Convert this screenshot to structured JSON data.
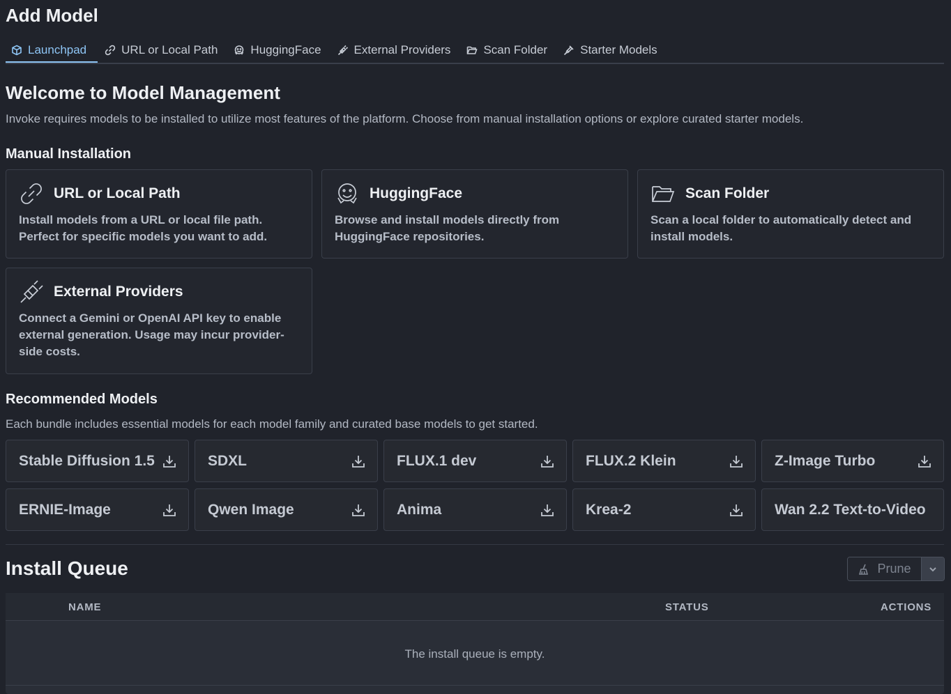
{
  "page": {
    "title": "Add Model"
  },
  "tabs": [
    {
      "label": "Launchpad",
      "icon": "cube-icon",
      "active": true
    },
    {
      "label": "URL or Local Path",
      "icon": "link-icon",
      "active": false
    },
    {
      "label": "HuggingFace",
      "icon": "huggingface-icon",
      "active": false
    },
    {
      "label": "External Providers",
      "icon": "plug-icon",
      "active": false
    },
    {
      "label": "Scan Folder",
      "icon": "folder-icon",
      "active": false
    },
    {
      "label": "Starter Models",
      "icon": "flask-icon",
      "active": false
    }
  ],
  "welcome": {
    "title": "Welcome to Model Management",
    "description": "Invoke requires models to be installed to utilize most features of the platform. Choose from manual installation options or explore curated starter models."
  },
  "manual": {
    "heading": "Manual Installation",
    "cards": [
      {
        "title": "URL or Local Path",
        "icon": "link-icon",
        "description": "Install models from a URL or local file path. Perfect for specific models you want to add."
      },
      {
        "title": "HuggingFace",
        "icon": "huggingface-icon",
        "description": "Browse and install models directly from HuggingFace repositories."
      },
      {
        "title": "Scan Folder",
        "icon": "folder-icon",
        "description": "Scan a local folder to automatically detect and install models."
      },
      {
        "title": "External Providers",
        "icon": "plug-icon",
        "description": "Connect a Gemini or OpenAI API key to enable external generation. Usage may incur provider-side costs."
      }
    ]
  },
  "recommended": {
    "heading": "Recommended Models",
    "description": "Each bundle includes essential models for each model family and curated base models to get started.",
    "bundles": [
      "Stable Diffusion 1.5",
      "SDXL",
      "FLUX.1 dev",
      "FLUX.2 Klein",
      "Z-Image Turbo",
      "ERNIE-Image",
      "Qwen Image",
      "Anima",
      "Krea-2",
      "Wan 2.2 Text-to-Video"
    ]
  },
  "queue": {
    "title": "Install Queue",
    "prune_label": "Prune",
    "columns": {
      "name": "NAME",
      "status": "STATUS",
      "actions": "ACTIONS"
    },
    "empty_message": "The install queue is empty."
  },
  "colors": {
    "background": "#20232b",
    "accent": "#8ec5f5",
    "card_border": "#3a3f4a"
  }
}
